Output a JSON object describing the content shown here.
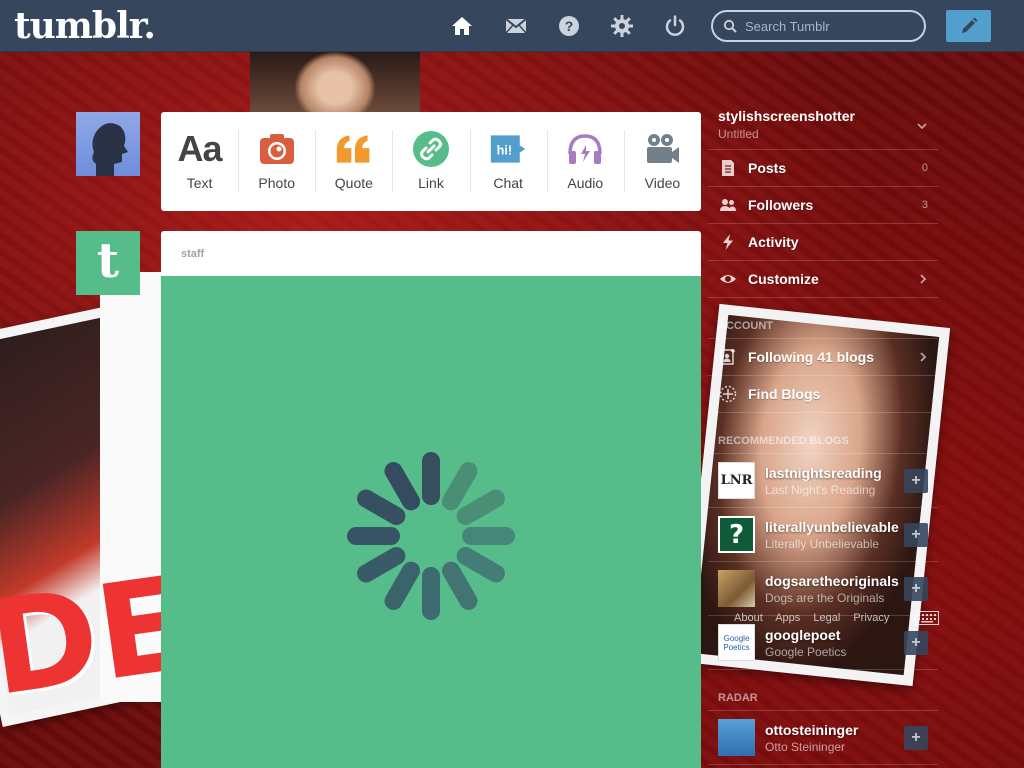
{
  "header": {
    "logo": "tumblr.",
    "search_placeholder": "Search Tumblr",
    "nav_icons": [
      "home-icon",
      "mail-icon",
      "help-icon",
      "gear-icon",
      "power-icon"
    ],
    "compose_icon": "pencil-icon"
  },
  "post_types": [
    {
      "label": "Text",
      "icon": "text-icon",
      "color": "#444444"
    },
    {
      "label": "Photo",
      "icon": "camera-icon",
      "color": "#d95e40"
    },
    {
      "label": "Quote",
      "icon": "quote-icon",
      "color": "#f2992e"
    },
    {
      "label": "Link",
      "icon": "link-icon",
      "color": "#56bc8a"
    },
    {
      "label": "Chat",
      "icon": "chat-icon",
      "color": "#529ecc"
    },
    {
      "label": "Audio",
      "icon": "headphones-icon",
      "color": "#a77dc2"
    },
    {
      "label": "Video",
      "icon": "video-camera-icon",
      "color": "#748089"
    }
  ],
  "staff_avatar_letter": "t",
  "post": {
    "author": "staff",
    "body_color": "#56bc8a",
    "state": "loading"
  },
  "sidebar": {
    "blog_name": "stylishscreenshotter",
    "blog_subtitle": "Untitled",
    "items": [
      {
        "label": "Posts",
        "count": "0",
        "icon": "posts-icon"
      },
      {
        "label": "Followers",
        "count": "3",
        "icon": "followers-icon"
      },
      {
        "label": "Activity",
        "count": "",
        "icon": "lightning-icon"
      },
      {
        "label": "Customize",
        "count": "",
        "icon": "eye-icon"
      }
    ],
    "account_title": "ACCOUNT",
    "account_items": [
      {
        "label": "Following 41 blogs",
        "icon": "following-icon"
      },
      {
        "label": "Find Blogs",
        "icon": "compass-icon"
      }
    ],
    "recommended_title": "RECOMMENDED BLOGS",
    "recommended": [
      {
        "name": "lastnightsreading",
        "desc": "Last Night's Reading",
        "avatar_text": "LNR"
      },
      {
        "name": "literallyunbelievable",
        "desc": "Literally Unbelievable",
        "avatar_text": "?"
      },
      {
        "name": "dogsaretheoriginals",
        "desc": "Dogs are the Originals",
        "avatar_text": ""
      },
      {
        "name": "googlepoet",
        "desc": "Google Poetics",
        "avatar_text": "Google Poetics"
      }
    ],
    "footer_links": [
      "About",
      "Apps",
      "Legal",
      "Privacy"
    ],
    "radar_title": "RADAR",
    "radar": [
      {
        "name": "ottosteininger",
        "desc": "Otto Steininger"
      }
    ]
  }
}
